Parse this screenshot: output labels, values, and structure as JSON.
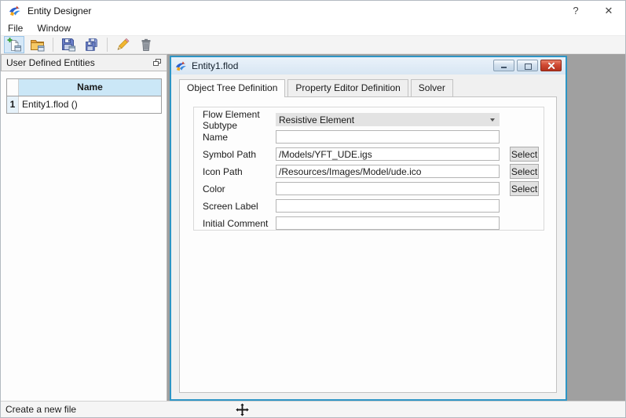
{
  "window": {
    "title": "Entity Designer",
    "controls": {
      "help": "?",
      "close": "✕"
    }
  },
  "menu": {
    "items": [
      {
        "label": "File"
      },
      {
        "label": "Window"
      }
    ]
  },
  "toolbar": {
    "buttons": [
      {
        "id": "new-file",
        "icon": "new-file-icon",
        "active": true
      },
      {
        "id": "open-file",
        "icon": "open-folder-icon",
        "active": false
      },
      {
        "id": "save",
        "icon": "save-icon",
        "active": false
      },
      {
        "id": "save-all",
        "icon": "save-all-icon",
        "active": false
      },
      {
        "id": "edit",
        "icon": "pencil-icon",
        "active": false
      },
      {
        "id": "delete",
        "icon": "trash-icon",
        "active": false
      }
    ]
  },
  "left_panel": {
    "title": "User Defined Entities",
    "float_icon": "float-panel-icon",
    "table": {
      "columns": [
        "Name"
      ],
      "rows": [
        {
          "num": "1",
          "name": "Entity1.flod ()"
        }
      ]
    }
  },
  "child_window": {
    "title": "Entity1.flod",
    "controls": [
      "minimize",
      "maximize",
      "close"
    ],
    "tabs": [
      {
        "label": "Object Tree Definition",
        "active": true
      },
      {
        "label": "Property Editor Definition",
        "active": false
      },
      {
        "label": "Solver",
        "active": false
      }
    ],
    "form": {
      "fields": [
        {
          "label": "Flow Element Subtype",
          "type": "dropdown",
          "value": "Resistive Element"
        },
        {
          "label": "Name",
          "type": "text",
          "value": ""
        },
        {
          "label": "Symbol Path",
          "type": "text",
          "value": "/Models/YFT_UDE.igs",
          "button": "Select"
        },
        {
          "label": "Icon Path",
          "type": "text",
          "value": "/Resources/Images/Model/ude.ico",
          "button": "Select"
        },
        {
          "label": "Color",
          "type": "text",
          "value": "",
          "button": "Select"
        },
        {
          "label": "Screen Label",
          "type": "text",
          "value": ""
        },
        {
          "label": "Initial Comment",
          "type": "text",
          "value": ""
        }
      ]
    }
  },
  "status_bar": {
    "text": "Create a new file"
  },
  "colors": {
    "selection_blue": "#cbe7f7",
    "child_border": "#2e95c5",
    "close_red": "#cf4434",
    "mdi_gray": "#a0a0a0",
    "toolbar_highlight": "#d5e8f8"
  }
}
